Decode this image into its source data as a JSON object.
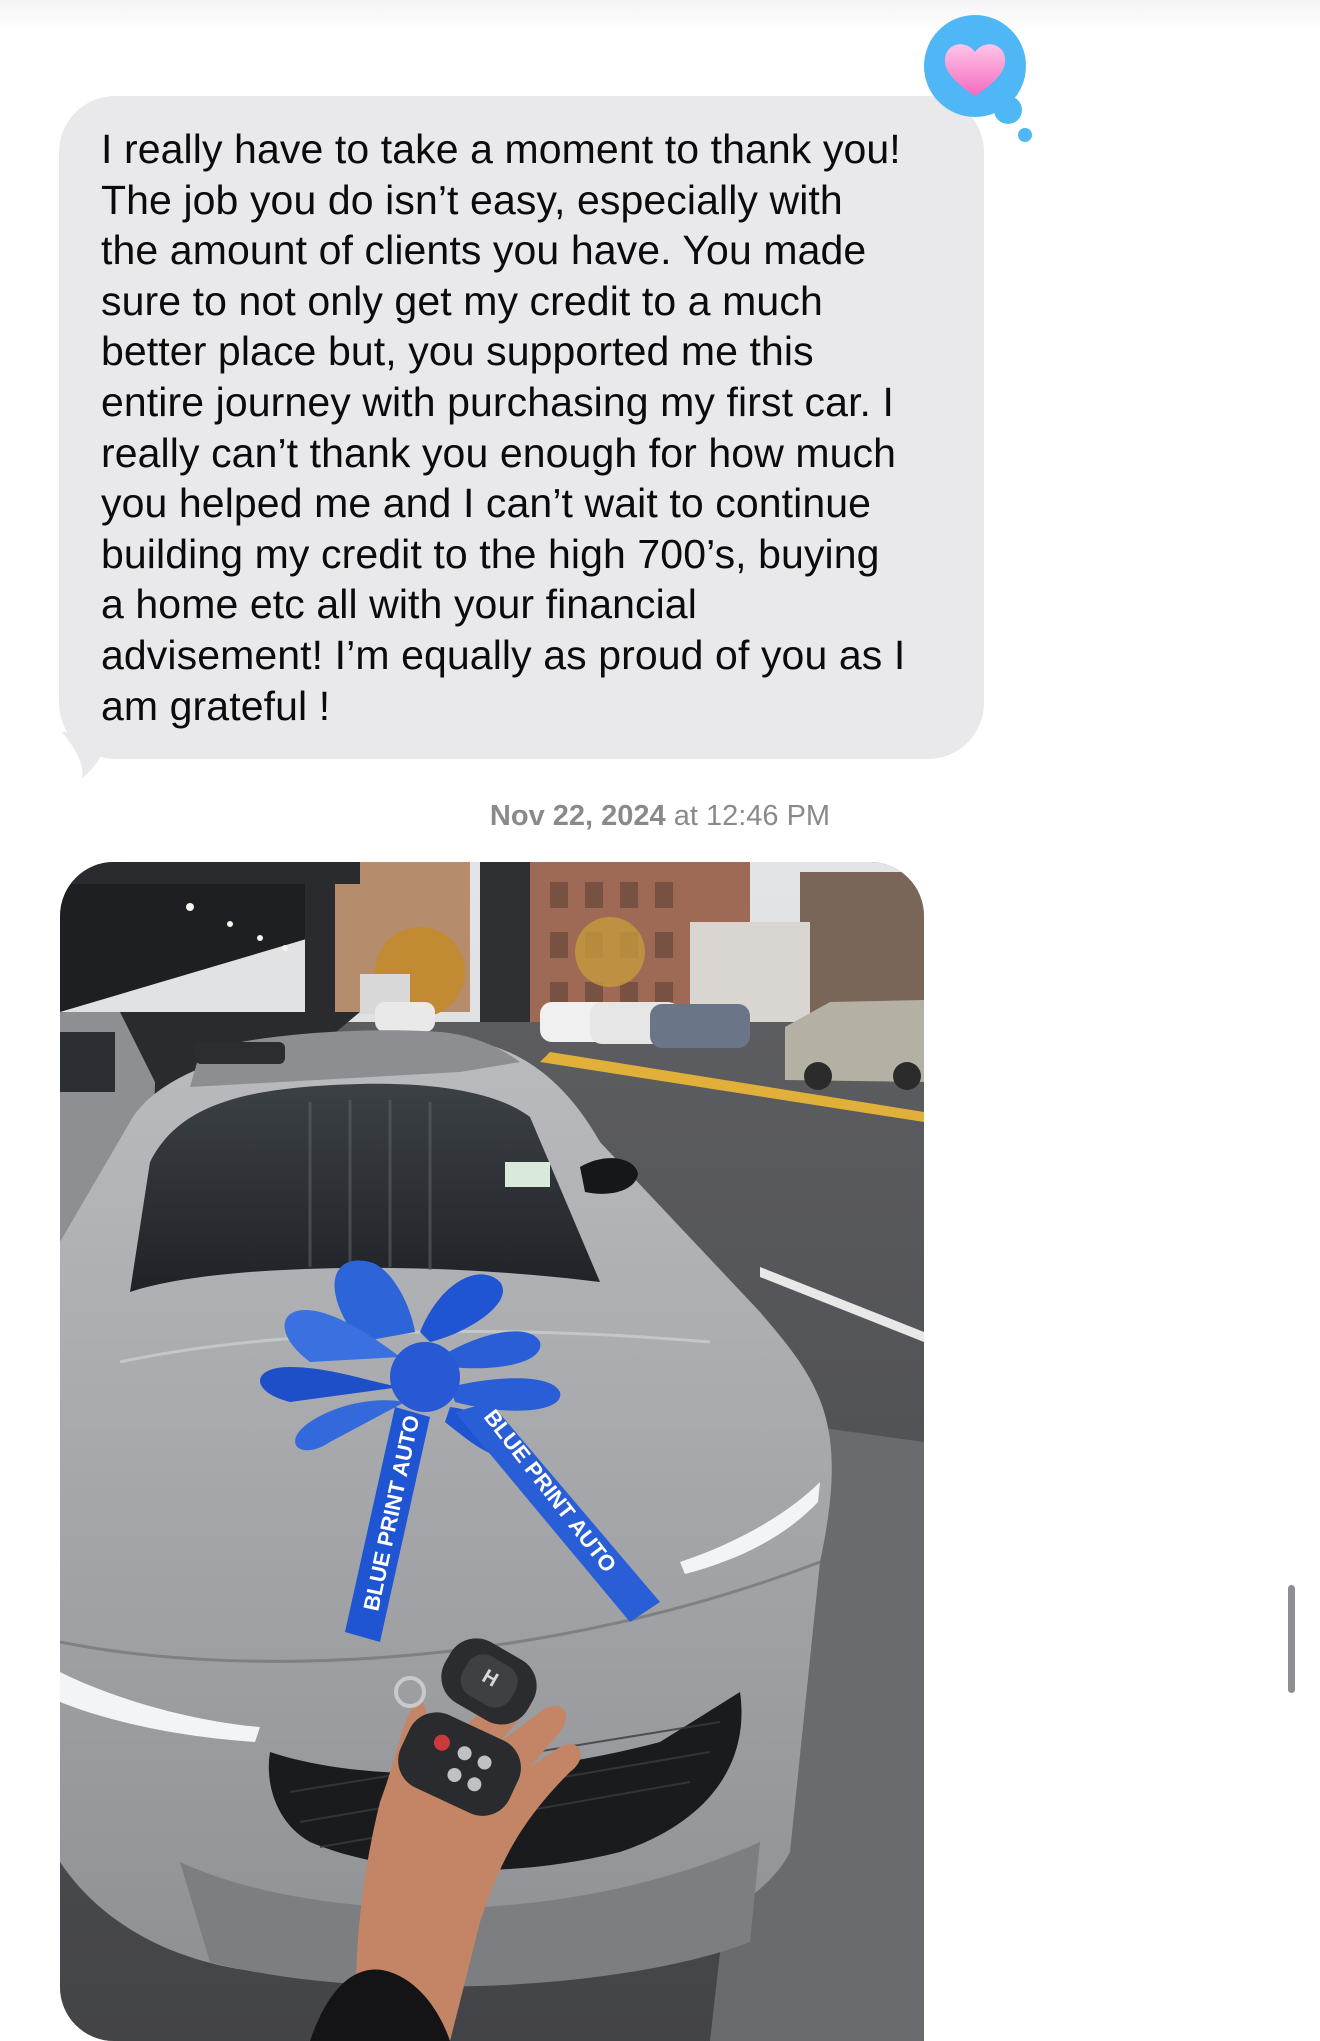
{
  "conversation": {
    "received_message": {
      "text": "I really have to take a moment to thank you!\nThe job you do isn’t easy, especially with\nthe amount of clients you have. You made\nsure to not only get my credit to a much\nbetter place but, you supported me this\nentire journey with purchasing my first car. I\nreally can’t thank you enough for how much\nyou helped me and I can’t wait to continue\nbuilding my credit to the high 700’s, buying\na home etc all with your financial\nadvisement! I’m equally as proud of you as I\nam grateful !",
      "reaction": "heart-tapback-icon",
      "bubble_color": "#e9e9eb",
      "reaction_color": "#4fb7f5"
    },
    "timestamp": {
      "date": "Nov 22, 2024",
      "separator": " at ",
      "time": "12:46 PM"
    },
    "photo_message": {
      "ribbon_text_left": "BLUE PRINT AUTO",
      "ribbon_text_right": "BLUE PRINT AUTO",
      "bow_color": "#1f55d2",
      "car_color": "#a8aaad"
    }
  }
}
